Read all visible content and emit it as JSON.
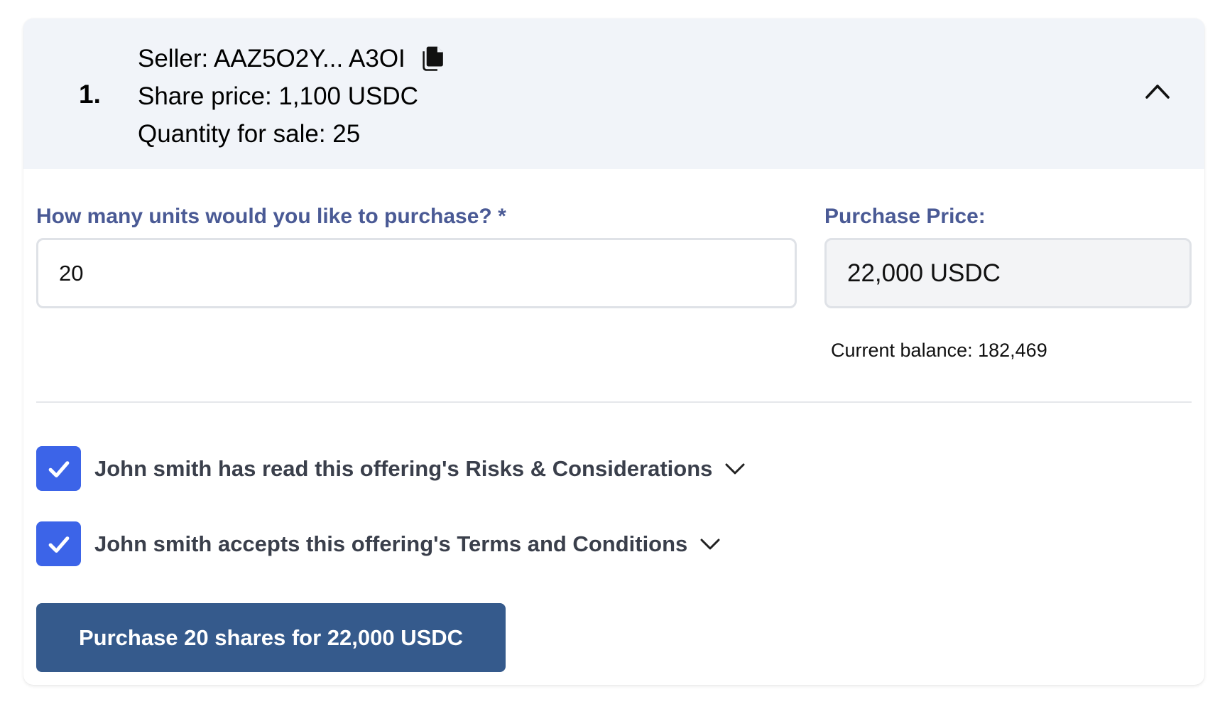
{
  "offer": {
    "index": "1.",
    "seller": "Seller: AAZ5O2Y... A3OI",
    "share_price": "Share price: 1,100 USDC",
    "quantity": "Quantity for sale: 25"
  },
  "form": {
    "units_label": "How many units would you like to purchase? *",
    "units_value": "20",
    "price_label": "Purchase Price:",
    "price_value": "22,000 USDC",
    "balance": "Current balance: 182,469"
  },
  "agreements": [
    {
      "label": "John smith has read this offering's Risks & Considerations",
      "checked": true
    },
    {
      "label": "John smith accepts this offering's Terms and Conditions",
      "checked": true
    }
  ],
  "purchase_button": "Purchase 20 shares for 22,000 USDC",
  "colors": {
    "header_bg": "#f1f4f9",
    "label": "#4a5a95",
    "checkbox": "#3c64e8",
    "button": "#355a8c"
  },
  "icons": {
    "copy": "copy-icon",
    "collapse": "chevron-up-icon",
    "expand": "chevron-down-icon",
    "check": "checkmark-icon"
  }
}
